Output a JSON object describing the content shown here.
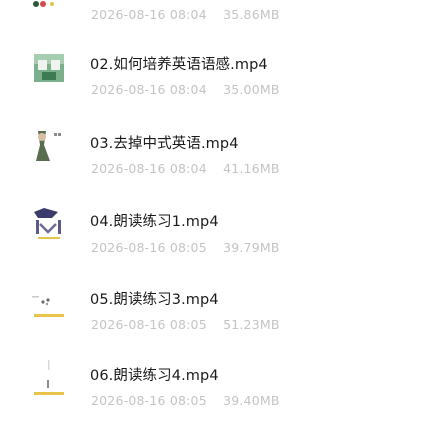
{
  "files": [
    {
      "name": "",
      "date": "2026-08-16",
      "time": "08:04",
      "size": "35.86MB",
      "icon": "video-thumbnail-icon"
    },
    {
      "name": "02.如何培养英语语感.mp4",
      "date": "2026-08-16",
      "time": "08:04",
      "size": "35.00MB",
      "icon": "video-thumbnail-icon"
    },
    {
      "name": "03.去掉中式英语.mp4",
      "date": "2026-08-16",
      "time": "08:04",
      "size": "41.16MB",
      "icon": "video-thumbnail-icon"
    },
    {
      "name": "04.朗读练习1.mp4",
      "date": "2026-08-16",
      "time": "08:05",
      "size": "39.79MB",
      "icon": "video-thumbnail-icon"
    },
    {
      "name": "05.朗读练习3.mp4",
      "date": "2026-08-16",
      "time": "08:05",
      "size": "51.23MB",
      "icon": "video-thumbnail-icon"
    },
    {
      "name": "06.朗读练习4.mp4",
      "date": "2026-08-16",
      "time": "08:05",
      "size": "39.40MB",
      "icon": "video-thumbnail-icon"
    }
  ]
}
